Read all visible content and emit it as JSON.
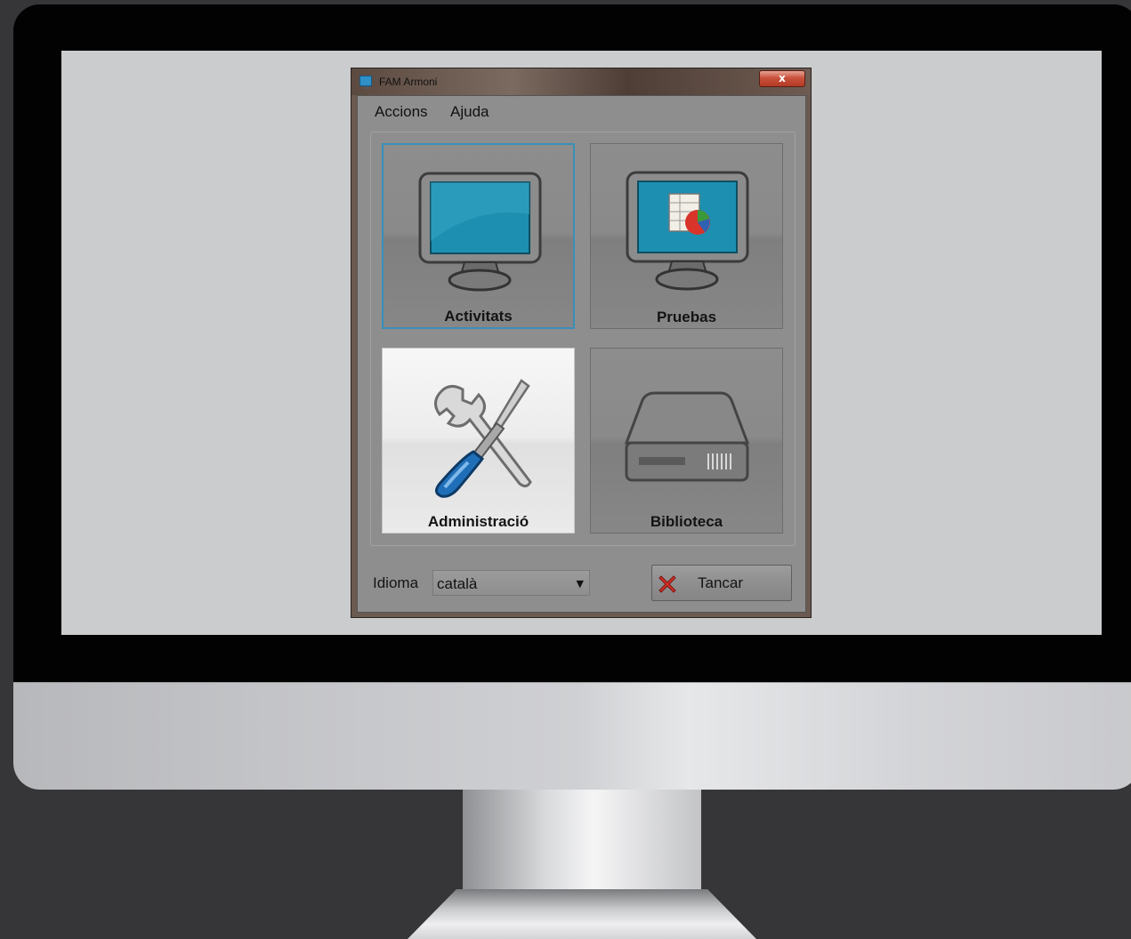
{
  "window": {
    "title": "FAM Armoni",
    "close_glyph": "x"
  },
  "menu": {
    "items": [
      {
        "label": "Accions"
      },
      {
        "label": "Ajuda"
      }
    ]
  },
  "tiles": [
    {
      "label": "Activitats",
      "icon": "monitor-icon",
      "state": "focused"
    },
    {
      "label": "Pruebas",
      "icon": "monitor-chart-icon",
      "state": "normal"
    },
    {
      "label": "Administració",
      "icon": "tools-icon",
      "state": "hover"
    },
    {
      "label": "Biblioteca",
      "icon": "hard-drive-icon",
      "state": "normal"
    }
  ],
  "footer": {
    "language_label": "Idioma",
    "language_value": "català",
    "close_button_label": "Tancar",
    "close_button_icon": "red-x-icon"
  },
  "colors": {
    "screen_blue": "#1d8fb0",
    "focus_border": "#3a8fb8",
    "close_red": "#c9523d"
  }
}
